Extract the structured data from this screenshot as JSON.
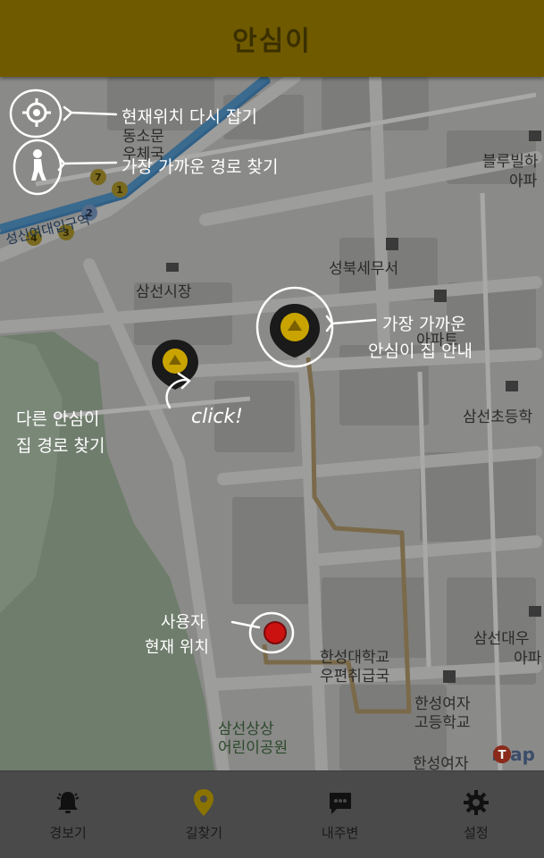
{
  "app": {
    "title": "안심이"
  },
  "map_labels": {
    "dongsomun": "동소문",
    "bank": "우체국",
    "station": "성신여대입구역",
    "samseon_market": "삼선시장",
    "seongbuk_office": "성북세무서",
    "apt": "아파트",
    "samseon_elem": "삼선초등학",
    "blue_villa": "블루빌하",
    "apa": "아파",
    "samseon_univ": "삼선대우",
    "apa2": "아파",
    "hansung_post": "한성대학교\n우편취급국",
    "hansung_girls": "한성여자\n고등학교",
    "hansung_girls2": "한성여자",
    "park": "삼선상상\n어린이공원",
    "brand": "map"
  },
  "annotations": {
    "relocate": "현재위치 다시 잡기",
    "nearest_route": "가장 가까운 경로 찾기",
    "nearest_house_1": "가장 가까운",
    "nearest_house_2": "안심이 집 안내",
    "other_route_1": "다른 안심이",
    "other_route_2": "집 경로 찾기",
    "click": "click!",
    "user_1": "사용자",
    "user_2": "현재 위치"
  },
  "subway_badges": [
    "7",
    "1",
    "2",
    "4",
    "3"
  ],
  "tabs": [
    {
      "label": "경보기",
      "icon": "bell-icon",
      "active": false
    },
    {
      "label": "길찾기",
      "icon": "location-pin-icon",
      "active": true
    },
    {
      "label": "내주변",
      "icon": "chat-icon",
      "active": false
    },
    {
      "label": "설정",
      "icon": "gear-icon",
      "active": false
    }
  ],
  "colors": {
    "header": "#6f5a00",
    "pin_yellow": "#c9a400",
    "route": "#7a6a4a",
    "user_dot": "#cc1111"
  }
}
